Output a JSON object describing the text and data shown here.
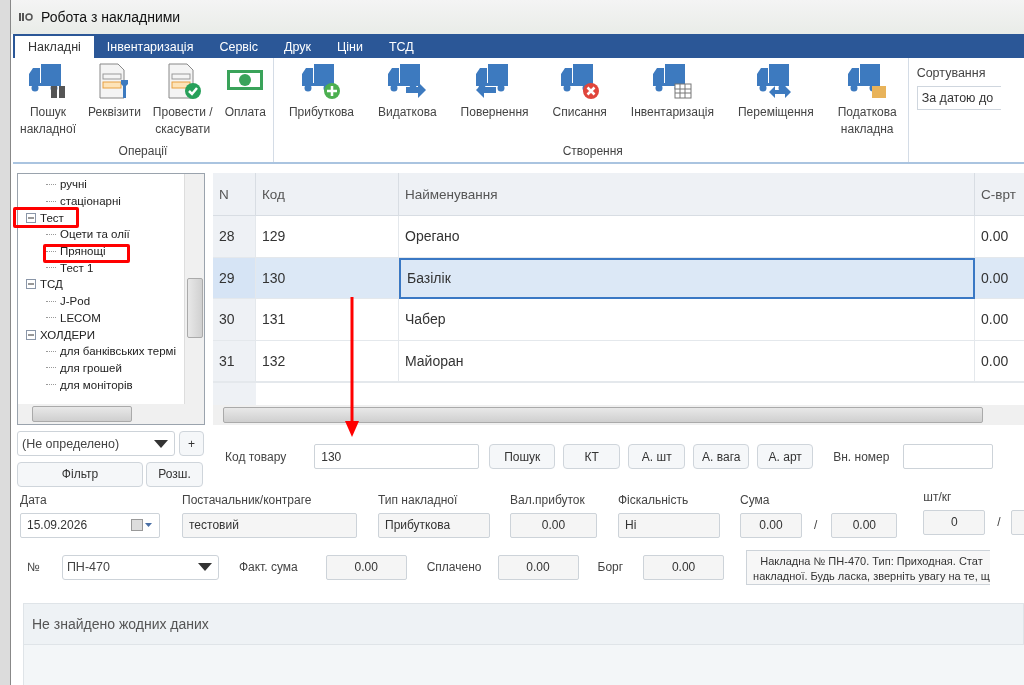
{
  "window": {
    "title": "Робота з накладними"
  },
  "tabs": [
    {
      "label": "Накладні",
      "selected": true
    },
    {
      "label": "Інвентаризація",
      "selected": false
    },
    {
      "label": "Сервіс",
      "selected": false
    },
    {
      "label": "Друк",
      "selected": false
    },
    {
      "label": "Ціни",
      "selected": false
    },
    {
      "label": "ТСД",
      "selected": false
    }
  ],
  "ribbon": {
    "groups": [
      {
        "label": "Операції",
        "buttons": [
          {
            "label": "Пошук\nнакладної"
          },
          {
            "label": "Реквізити"
          },
          {
            "label": "Провести /\nскасувати"
          },
          {
            "label": "Оплата"
          }
        ]
      },
      {
        "label": "Створення",
        "buttons": [
          {
            "label": "Прибуткова"
          },
          {
            "label": "Видаткова"
          },
          {
            "label": "Повернення"
          },
          {
            "label": "Списання"
          },
          {
            "label": "Інвентаризація"
          },
          {
            "label": "Переміщення"
          },
          {
            "label": "Податкова\nнакладна"
          }
        ]
      }
    ],
    "sort": {
      "label": "Сортування",
      "value": "За датою до"
    }
  },
  "tree": {
    "items": [
      {
        "children": [
          {
            "label": "ручні"
          },
          {
            "label": "стаціонарні"
          }
        ]
      },
      {
        "label": "Тест",
        "expanded": true,
        "children": [
          {
            "label": "Оцети та олії"
          },
          {
            "label": "Прянощі"
          },
          {
            "label": "Тест 1"
          }
        ]
      },
      {
        "label": "ТСД",
        "expanded": true,
        "children": [
          {
            "label": "J-Pod"
          },
          {
            "label": "LECOM"
          }
        ]
      },
      {
        "label": "ХОЛДЕРИ",
        "expanded": true,
        "children": [
          {
            "label": "для банківських термі"
          },
          {
            "label": "для грошей"
          },
          {
            "label": "для моніторів"
          }
        ]
      }
    ]
  },
  "grid": {
    "columns": [
      "N",
      "Код",
      "Найменування",
      "С-врт"
    ],
    "rows": [
      {
        "selected": false,
        "cells": [
          "28",
          "129",
          "Орегано",
          "0.00"
        ]
      },
      {
        "selected": true,
        "cells": [
          "29",
          "130",
          "Базілік",
          "0.00"
        ]
      },
      {
        "selected": false,
        "cells": [
          "30",
          "131",
          "Чабер",
          "0.00"
        ]
      },
      {
        "selected": false,
        "cells": [
          "31",
          "132",
          "Майоран",
          "0.00"
        ]
      }
    ]
  },
  "filter": {
    "group": "(Не определено)",
    "add": "+",
    "filter_button": "Фільтр",
    "extended_button": "Розш."
  },
  "search": {
    "label": "Код товару",
    "value": "130",
    "buttons": [
      "Пошук",
      "КТ",
      "А. шт",
      "А. вага",
      "А. арт"
    ],
    "ext_label": "Вн. номер"
  },
  "invoice": {
    "date_label": "Дата",
    "date": "15.09.2026",
    "supplier_label": "Постачальник/контраге",
    "supplier": "тестовий",
    "type_label": "Тип накладної",
    "type": "Прибуткова",
    "profit_label": "Вал.прибуток",
    "profit": "0.00",
    "fiscal_label": "Фіскальність",
    "fiscal": "Ні",
    "sum_label": "Сума",
    "sum1": "0.00",
    "sum2": "0.00",
    "qty_label": "шт/кг",
    "qty1": "0",
    "slash": "/",
    "number_label": "№",
    "number": "ПН-470",
    "fact_label": "Факт. сума",
    "fact": "0.00",
    "paid_label": "Сплачено",
    "paid": "0.00",
    "debt_label": "Борг",
    "debt": "0.00",
    "note": [
      "Накладна № ПН-470. Тип: Приходная. Стат",
      "накладної. Будь ласка, зверніть увагу на те, щ"
    ]
  },
  "details": {
    "empty_text": "Не знайдено жодних даних"
  }
}
